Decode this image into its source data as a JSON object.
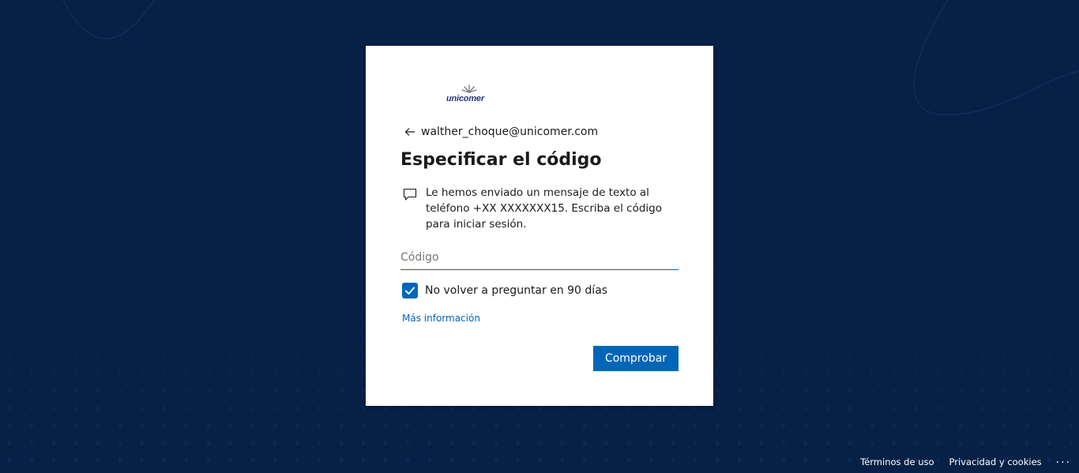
{
  "colors": {
    "background": "#062046",
    "accent": "#0067b8",
    "card": "#ffffff",
    "text": "#1b1b1b"
  },
  "logo": {
    "text": "unicomer",
    "icon": "sun-logo"
  },
  "identity": {
    "back_icon": "back-arrow-icon",
    "email": "walther_choque@unicomer.com"
  },
  "title": "Especificar el código",
  "message": {
    "icon": "message-bubble-icon",
    "text": "Le hemos enviado un mensaje de texto al teléfono +XX XXXXXXX15. Escriba el código para iniciar sesión."
  },
  "code_input": {
    "value": "",
    "placeholder": "Código"
  },
  "remember": {
    "checked": true,
    "label": "No volver a preguntar en 90 días"
  },
  "more_info_link": "Más información",
  "verify_button": "Comprobar",
  "footer": {
    "terms": "Términos de uso",
    "privacy": "Privacidad y cookies",
    "more": "..."
  }
}
